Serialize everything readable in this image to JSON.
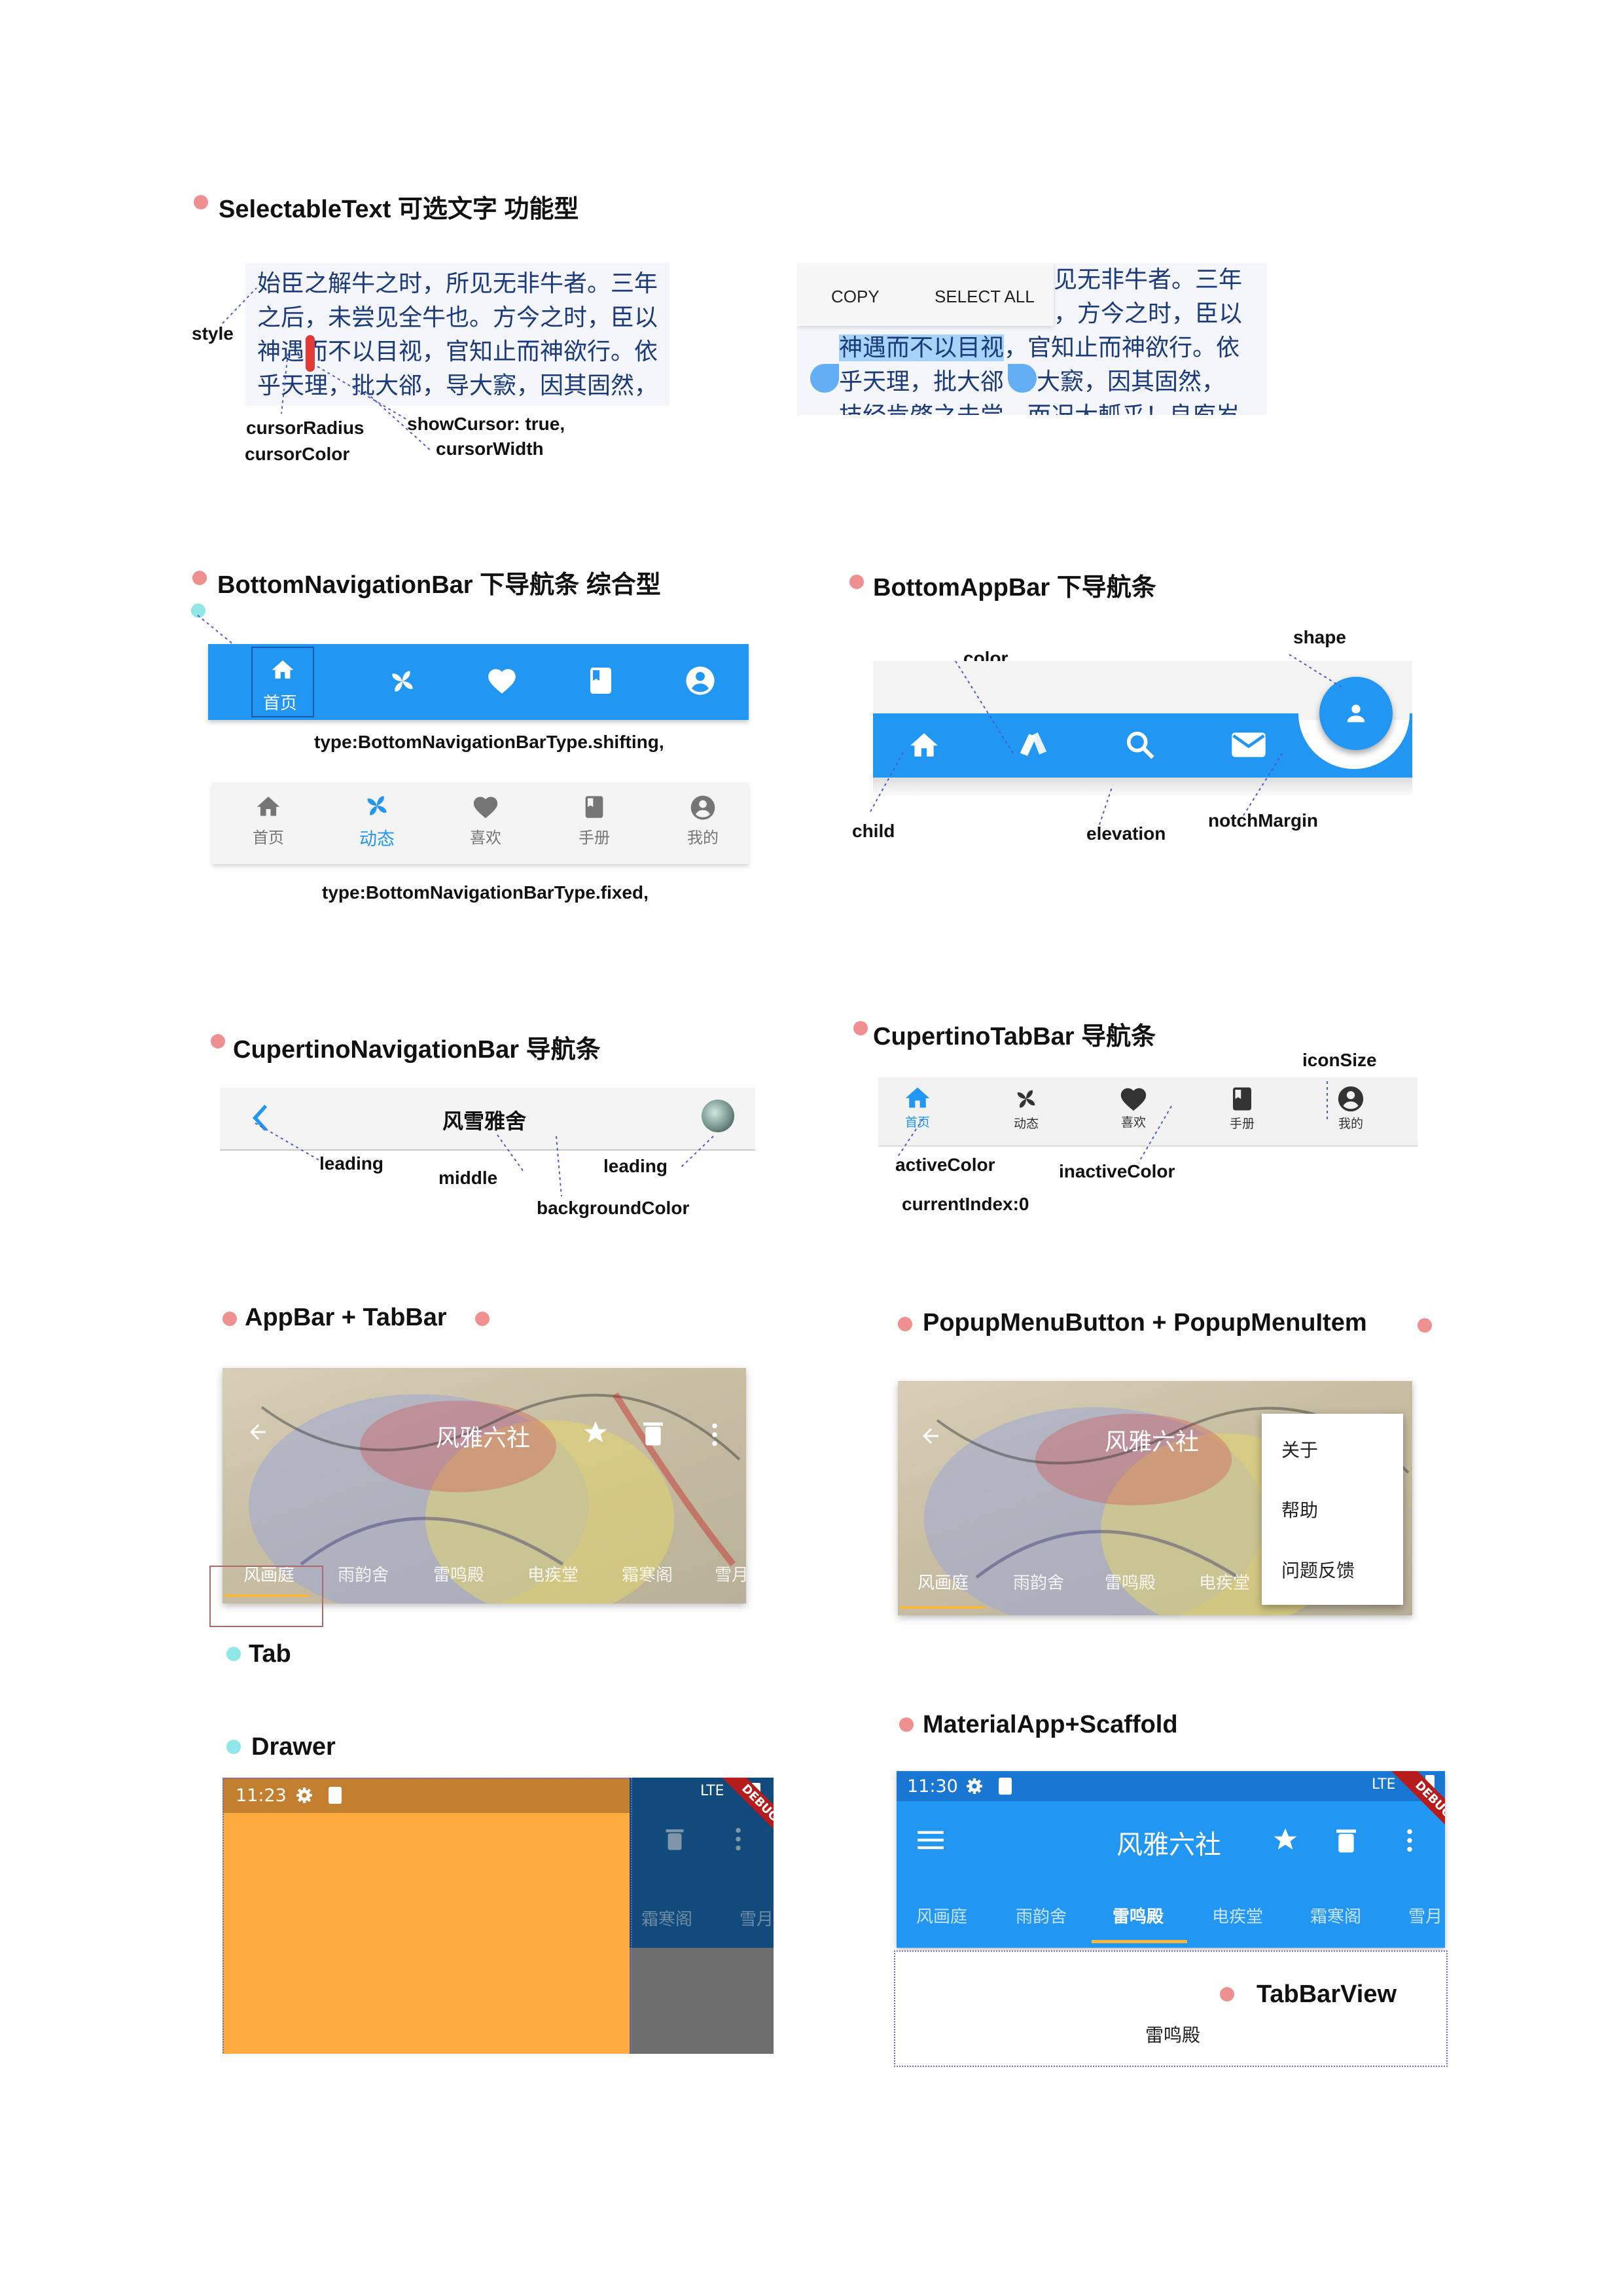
{
  "sections": {
    "selectable": {
      "title": "SelectableText 可选文字  功能型"
    },
    "bottom_nav": {
      "title": "BottomNavigationBar 下导航条      综合型"
    },
    "bottom_appbar": {
      "title": "BottomAppBar 下导航条"
    },
    "cupertino_nav": {
      "title": "CupertinoNavigationBar 导航条"
    },
    "cupertino_tab": {
      "title": "CupertinoTabBar 导航条"
    },
    "appbar_tabbar": {
      "title": "AppBar + TabBar"
    },
    "popup": {
      "title": "PopupMenuButton + PopupMenuItem"
    },
    "tab": {
      "title": "Tab"
    },
    "drawer": {
      "title": "Drawer"
    },
    "material": {
      "title": "MaterialApp+Scaffold"
    }
  },
  "selectable_text": {
    "lines": [
      "始臣之解牛之时，所见无非牛者。三年",
      "之后，未尝见全牛也。方今之时，臣以",
      "神遇而不以目视，官知止而神欲行。依",
      "乎天理，批大郤，导大窾，因其固然，"
    ],
    "right_lines": [
      "见无非牛者。三年",
      "，方今之时，臣以",
      "，官知止而神欲行。依",
      "导大窾，因其固然，",
      "技经肯綮之未尝，而况大軱乎！良庖岁"
    ],
    "right_selected": "神遇而不以目视",
    "right_line4_start": "乎天理，批大郤",
    "toolbar": {
      "copy": "COPY",
      "select_all": "SELECT ALL"
    },
    "labels": {
      "style": "style",
      "cursor_radius": "cursorRadius",
      "cursor_color": "cursorColor",
      "show_cursor": "showCursor: true,",
      "cursor_width": "cursorWidth"
    }
  },
  "bottom_nav": {
    "shifting_items": [
      "首页"
    ],
    "shifting_label": "type:BottomNavigationBarType.shifting,",
    "fixed_items": [
      "首页",
      "动态",
      "喜欢",
      "手册",
      "我的"
    ],
    "fixed_label": "type:BottomNavigationBarType.fixed,",
    "colors": {
      "primary": "#2196f3",
      "bar_bg": "#f2f2f2",
      "inactive": "#757575"
    }
  },
  "bottom_appbar": {
    "labels": {
      "color": "color",
      "shape": "shape",
      "child": "child",
      "elevation": "elevation",
      "notch_margin": "notchMargin"
    }
  },
  "cupertino_nav": {
    "title": "风雪雅舍",
    "labels": {
      "leading": "leading",
      "middle": "middle",
      "leading2": "leading",
      "background_color": "backgroundColor"
    }
  },
  "cupertino_tab": {
    "items": [
      "首页",
      "动态",
      "喜欢",
      "手册",
      "我的"
    ],
    "labels": {
      "icon_size": "iconSize",
      "active_color": "activeColor",
      "inactive_color": "inactiveColor",
      "current_index": "currentIndex:0"
    }
  },
  "appbar": {
    "title": "风雅六社",
    "tabs": [
      "风画庭",
      "雨韵舍",
      "雷鸣殿",
      "电疾堂",
      "霜寒阁",
      "雪月"
    ]
  },
  "popup": {
    "title": "风雅六社",
    "tabs": [
      "风画庭",
      "雨韵舍",
      "雷鸣殿",
      "电疾堂"
    ],
    "menu": [
      "关于",
      "帮助",
      "问题反馈"
    ]
  },
  "drawer": {
    "time": "11:23",
    "net": "LTE",
    "debug": "DEBUG",
    "tabs": [
      "霜寒阁",
      "雪月"
    ]
  },
  "material": {
    "time": "11:30",
    "net": "LTE",
    "debug": "DEBUG",
    "title": "风雅六社",
    "tabs": [
      "风画庭",
      "雨韵舍",
      "雷鸣殿",
      "电疾堂",
      "霜寒阁",
      "雪月"
    ],
    "selected_tab": "雷鸣殿",
    "tabbarview_label": "TabBarView",
    "tabbarview_content": "雷鸣殿"
  }
}
